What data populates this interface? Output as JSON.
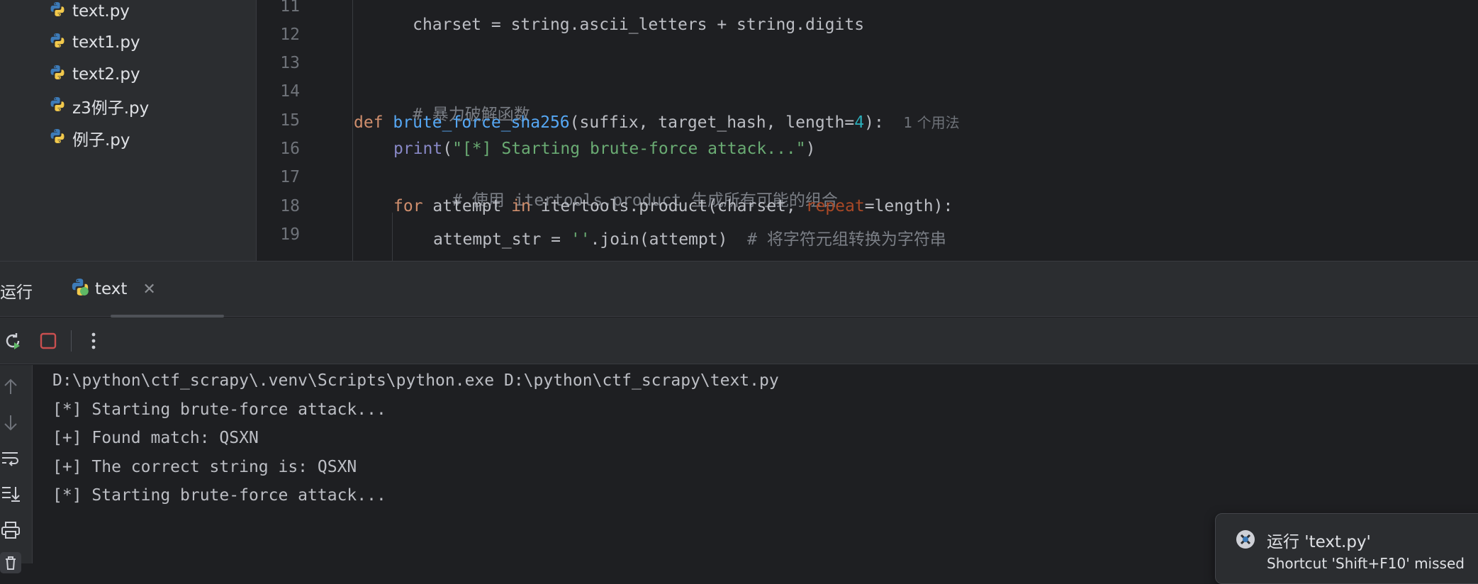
{
  "project_tree": {
    "files": [
      {
        "name": "text.py"
      },
      {
        "name": "text1.py"
      },
      {
        "name": "text2.py"
      },
      {
        "name": "z3例子.py"
      },
      {
        "name": "例子.py"
      }
    ]
  },
  "editor": {
    "line_numbers": [
      "11",
      "12",
      "13",
      "14",
      "15",
      "16",
      "17",
      "18",
      "19"
    ],
    "lines": {
      "l11": {
        "code": "charset = string.ascii_letters + string.digits"
      },
      "l14": {
        "comment": "# 暴力破解函数"
      },
      "l15": {
        "kw_def": "def",
        "fn_name": "brute_force_sha256",
        "params": "(suffix, target_hash, length=",
        "num": "4",
        "close": "):",
        "usage_hint": "1 个用法"
      },
      "l16": {
        "builtin": "print",
        "open": "(",
        "string": "\"[*] Starting brute-force attack...\"",
        "close": ")"
      },
      "l17": {
        "comment": "# 使用 itertools.product 生成所有可能的组合"
      },
      "l18": {
        "kw_for": "for",
        "var": " attempt ",
        "kw_in": "in",
        "call": " itertools.product(charset, ",
        "param": "repeat",
        "rest": "=length):"
      },
      "l19": {
        "pre": "attempt_str = ",
        "string": "''",
        "post": ".join(attempt)  ",
        "comment": "# 将字符元组转换为字符串"
      }
    }
  },
  "run_panel": {
    "title": "运行",
    "tab_label": "text",
    "console_lines": [
      "D:\\python\\ctf_scrapy\\.venv\\Scripts\\python.exe D:\\python\\ctf_scrapy\\text.py",
      "[*] Starting brute-force attack...",
      "[+] Found match: QSXN",
      "[+] The correct string is: QSXN",
      "[*] Starting brute-force attack..."
    ]
  },
  "notification": {
    "title": "运行 'text.py'",
    "subtitle": "Shortcut 'Shift+F10' missed"
  },
  "colors": {
    "background": "#1e1f22",
    "panel": "#2b2d30",
    "keyword": "#cf8e6d",
    "function": "#56a8f5",
    "string": "#6aab73",
    "number": "#2aacb8",
    "comment": "#7a7e85",
    "stop": "#c94f4f"
  }
}
